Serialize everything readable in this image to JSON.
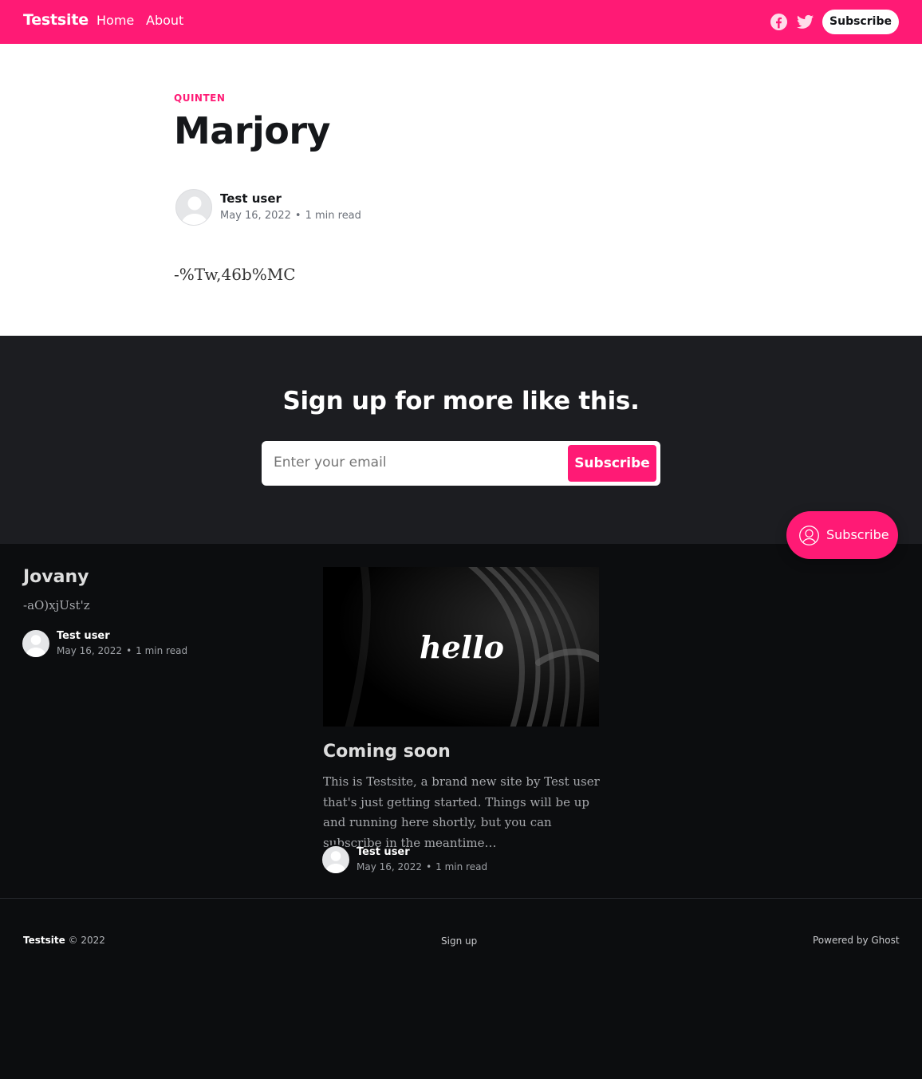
{
  "header": {
    "logo": "Testsite",
    "nav": [
      "Home",
      "About"
    ],
    "icons": [
      "facebook-icon",
      "twitter-icon"
    ],
    "subscribe_label": "Subscribe",
    "accent_color": "#ff1a75"
  },
  "article": {
    "tag": "QUINTEN",
    "title": "Marjory",
    "author": "Test user",
    "date": "May 16, 2022",
    "reading_time": "1 min read",
    "body": "-%Tw,46b%MC"
  },
  "cta": {
    "title": "Sign up for more like this.",
    "email_placeholder": "Enter your email",
    "button_label": "Subscribe"
  },
  "portal": {
    "label": "Subscribe"
  },
  "related": [
    {
      "title": "Jovany",
      "excerpt": "-aO)xjUst'z",
      "author": "Test user",
      "date": "May 16, 2022",
      "reading_time": "1 min read"
    },
    {
      "image_text": "hello",
      "title": "Coming soon",
      "excerpt": "This is Testsite, a brand new site by Test user that's just getting started. Things will be up and running here shortly, but you can subscribe in the meantime…",
      "author": "Test user",
      "date": "May 16, 2022",
      "reading_time": "1 min read"
    }
  ],
  "footer": {
    "site": "Testsite",
    "copyright": "© 2022",
    "signup": "Sign up",
    "powered": "Powered by Ghost"
  }
}
